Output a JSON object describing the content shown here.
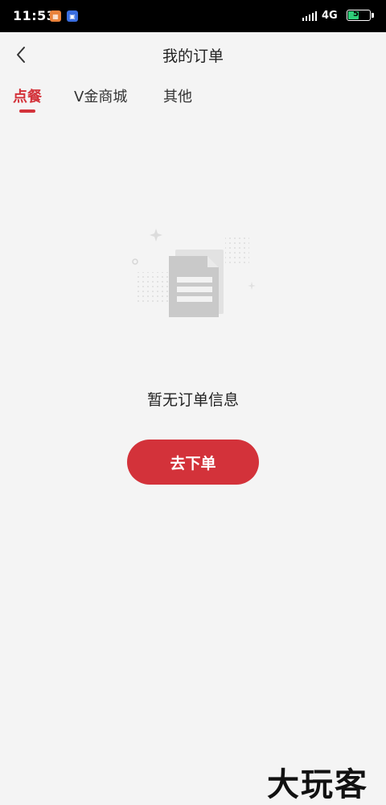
{
  "status_bar": {
    "time": "11:53",
    "network": "4G",
    "battery_level": "51",
    "battery_fill_fraction": 0.51,
    "battery_color": "#2fd07a",
    "notification_icons": [
      "app-notification-icon",
      "app-notification-icon"
    ]
  },
  "header": {
    "title": "我的订单",
    "back_icon": "chevron-left-icon"
  },
  "tabs": [
    {
      "label": "点餐",
      "active": true
    },
    {
      "label": "V金商城",
      "active": false
    },
    {
      "label": "其他",
      "active": false
    }
  ],
  "empty_state": {
    "illustration": "empty-document-icon",
    "message": "暂无订单信息",
    "button_label": "去下单"
  },
  "watermark": "大玩客",
  "colors": {
    "accent": "#d3323a",
    "background": "#f4f4f4",
    "text": "#222222"
  }
}
